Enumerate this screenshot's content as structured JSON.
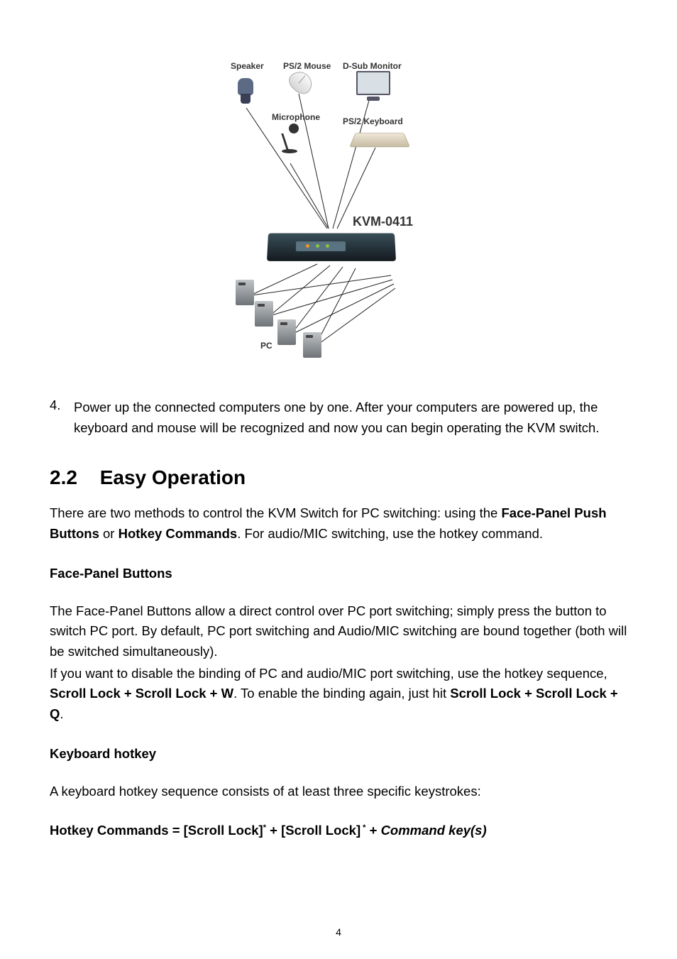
{
  "diagram": {
    "labels": {
      "speaker": "Speaker",
      "ps2_mouse": "PS/2 Mouse",
      "dsub_monitor": "D-Sub Monitor",
      "microphone": "Microphone",
      "ps2_keyboard": "PS/2 Keyboard",
      "kvm_model": "KVM-0411",
      "pc": "PC"
    }
  },
  "step4_num": "4.",
  "step4": "Power up the connected computers one by one. After your computers are powered up, the keyboard and mouse will be recognized and now you can begin operating the KVM switch.",
  "sec": {
    "num": "2.2",
    "title": "Easy Operation"
  },
  "intro_pre": "There are two methods to control the KVM Switch for PC switching: using the ",
  "intro_b1": "Face-Panel Push Buttons",
  "intro_mid": " or ",
  "intro_b2": "Hotkey Commands",
  "intro_post": ". For audio/MIC switching, use the hotkey command.",
  "h_face": "Face-Panel Buttons",
  "face_p1": "The Face-Panel Buttons allow a direct control over PC port switching; simply press the button to switch PC port. By default, PC port switching and Audio/MIC switching are bound together (both will be switched simultaneously).",
  "face_p2_pre": "If you want to disable the binding of PC and audio/MIC port switching, use the hotkey sequence, ",
  "face_p2_b1": "Scroll Lock + Scroll Lock + W",
  "face_p2_mid": ". To enable the binding again, just hit ",
  "face_p2_b2": "Scroll Lock + Scroll Lock + Q",
  "face_p2_post": ".",
  "h_kb": "Keyboard hotkey",
  "kb_p1": "A keyboard hotkey sequence consists of at least three specific keystrokes:",
  "formula": {
    "lhs": "Hotkey Commands = [Scroll Lock]",
    "sup1": "*",
    "plus1": " + [Scroll Lock]",
    "sup2": " *",
    "plus2": " + ",
    "cmd": "Command key(s)"
  },
  "page_num": "4"
}
